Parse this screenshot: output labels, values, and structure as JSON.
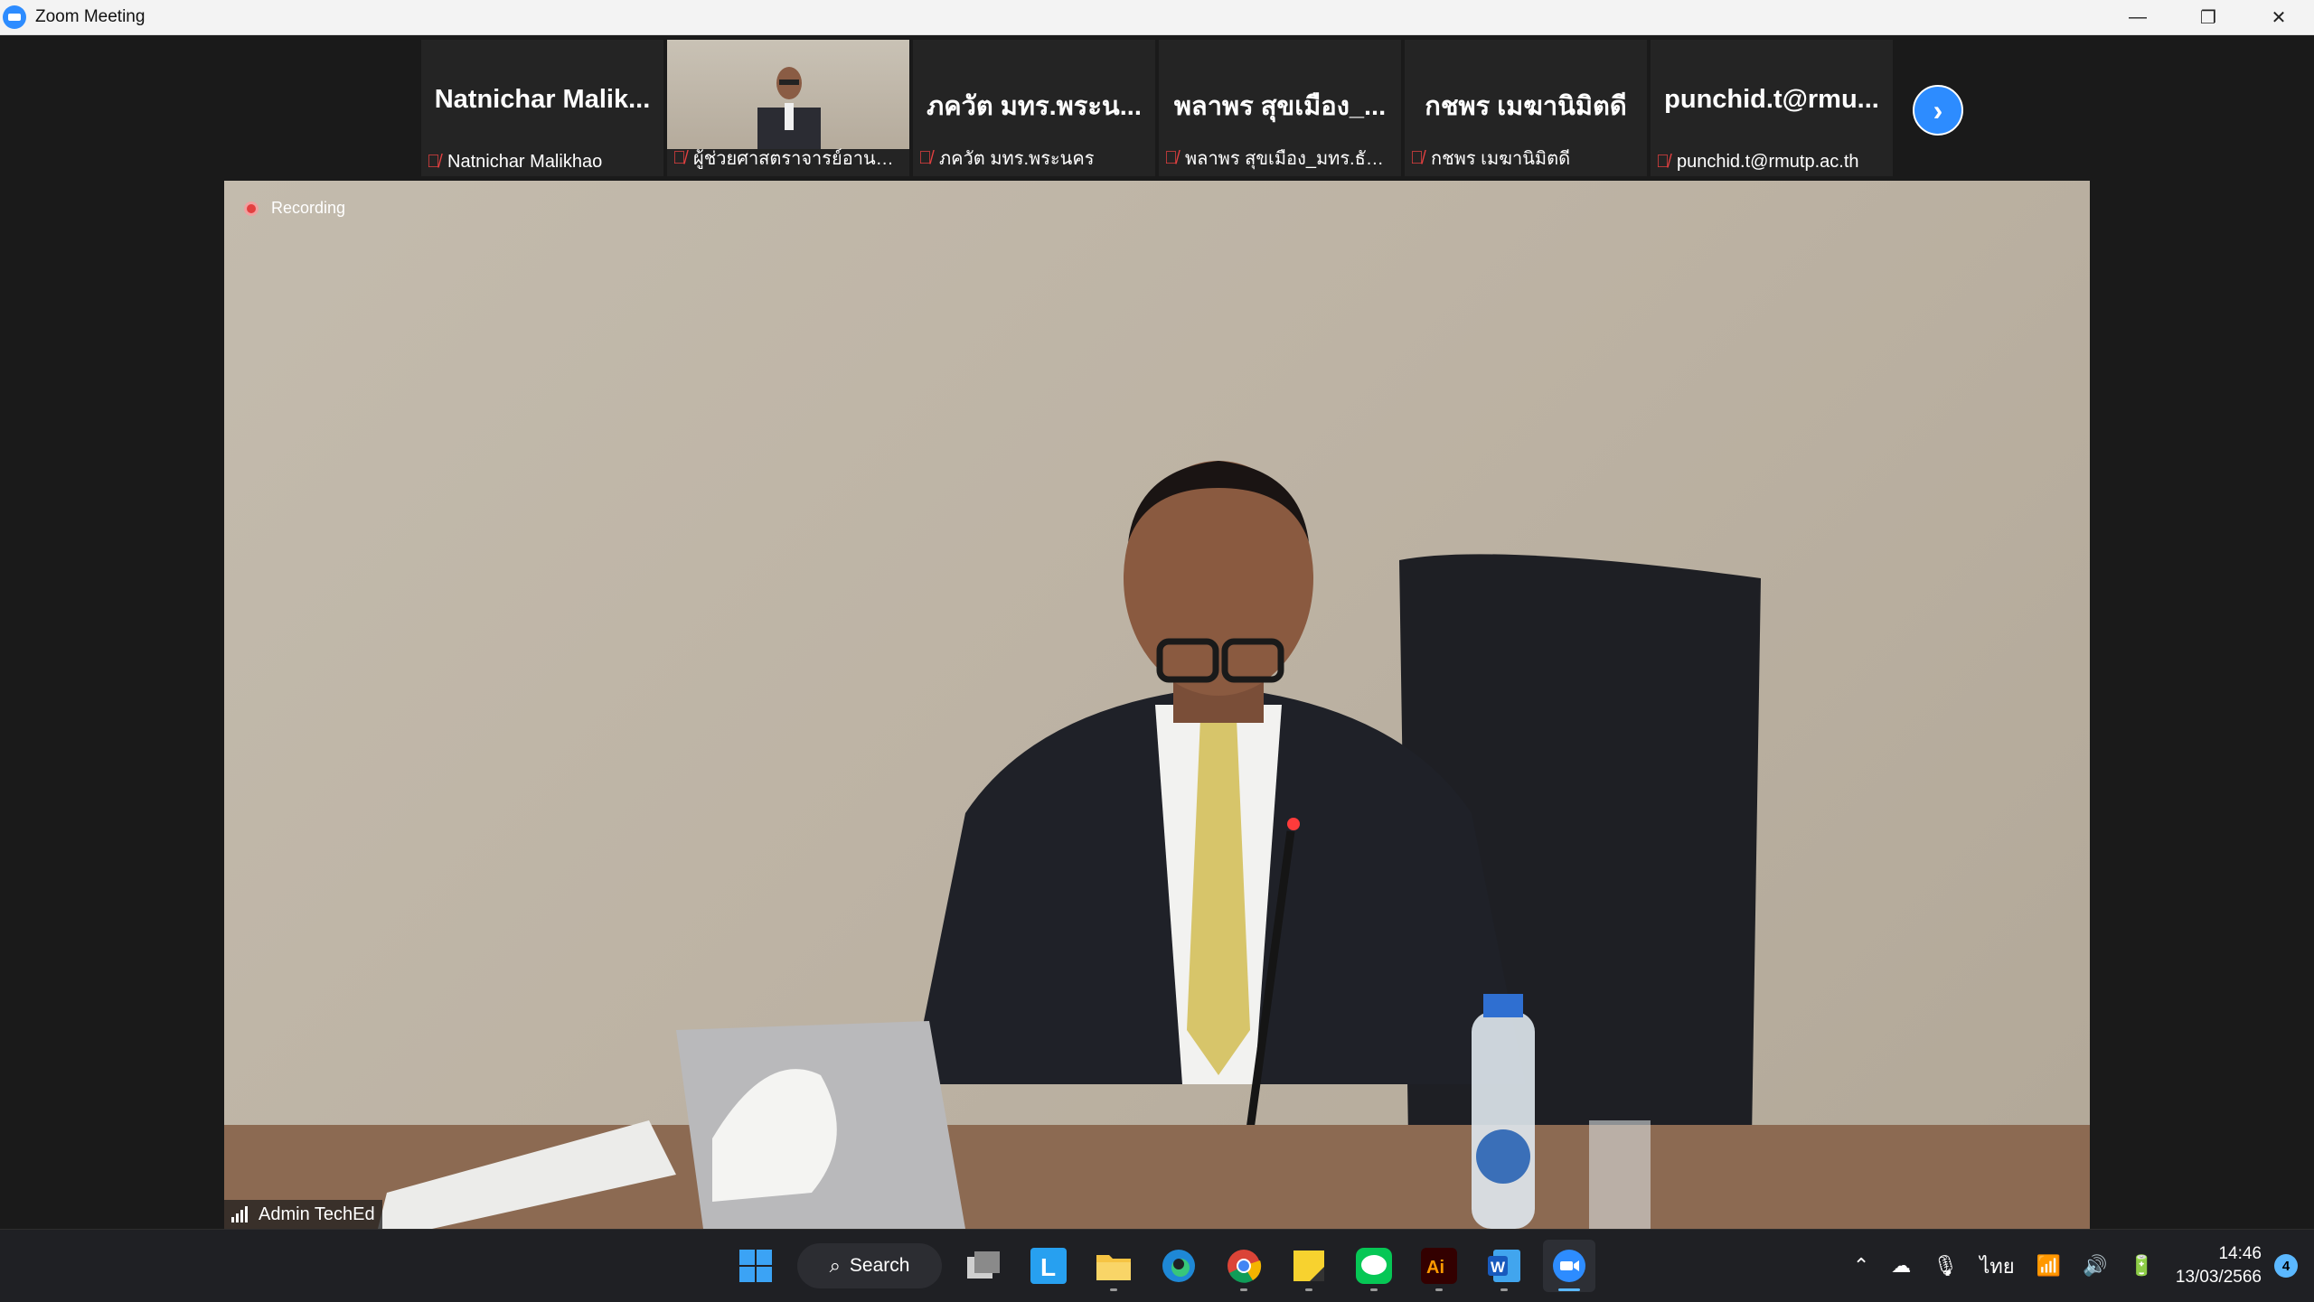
{
  "window": {
    "title": "Zoom Meeting",
    "minimize_glyph": "—",
    "restore_glyph": "❐",
    "close_glyph": "✕"
  },
  "gallery": {
    "tiles": [
      {
        "display_name": "Natnichar  Malik...",
        "label": "Natnichar Malikhao",
        "muted": true,
        "video": false
      },
      {
        "display_name": "",
        "label": "ผู้ช่วยศาสตราจารย์อานนท์...",
        "muted": true,
        "video": true
      },
      {
        "display_name": "ภควัต มทร.พระน...",
        "label": "ภควัต มทร.พระนคร",
        "muted": true,
        "video": false
      },
      {
        "display_name": "พลาพร สุขเมือง_...",
        "label": "พลาพร สุขเมือง_มทร.ธัญบุรี",
        "muted": true,
        "video": false
      },
      {
        "display_name": "กชพร เมฆานิมิตดี",
        "label": "กชพร เมฆานิมิตดี",
        "muted": true,
        "video": false
      },
      {
        "display_name": "punchid.t@rmu...",
        "label": "punchid.t@rmutp.ac.th",
        "muted": true,
        "video": false
      }
    ],
    "next_glyph": "›"
  },
  "main": {
    "recording_label": "Recording",
    "speaker_name": "Admin TechEd"
  },
  "taskbar": {
    "search_label": "Search",
    "apps": [
      "start-icon",
      "search",
      "file-manager-icon",
      "l-app-icon",
      "folder-icon",
      "edge-icon",
      "chrome-icon",
      "sticky-notes-icon",
      "line-icon",
      "illustrator-icon",
      "word-icon",
      "zoom-icon"
    ],
    "tray": {
      "language": "ไทย",
      "time": "14:46",
      "date": "13/03/2566",
      "notifications": "4"
    }
  },
  "colors": {
    "zoom_blue": "#2d8cff",
    "mute_red": "#e34040",
    "taskbar": "#1f2024"
  }
}
